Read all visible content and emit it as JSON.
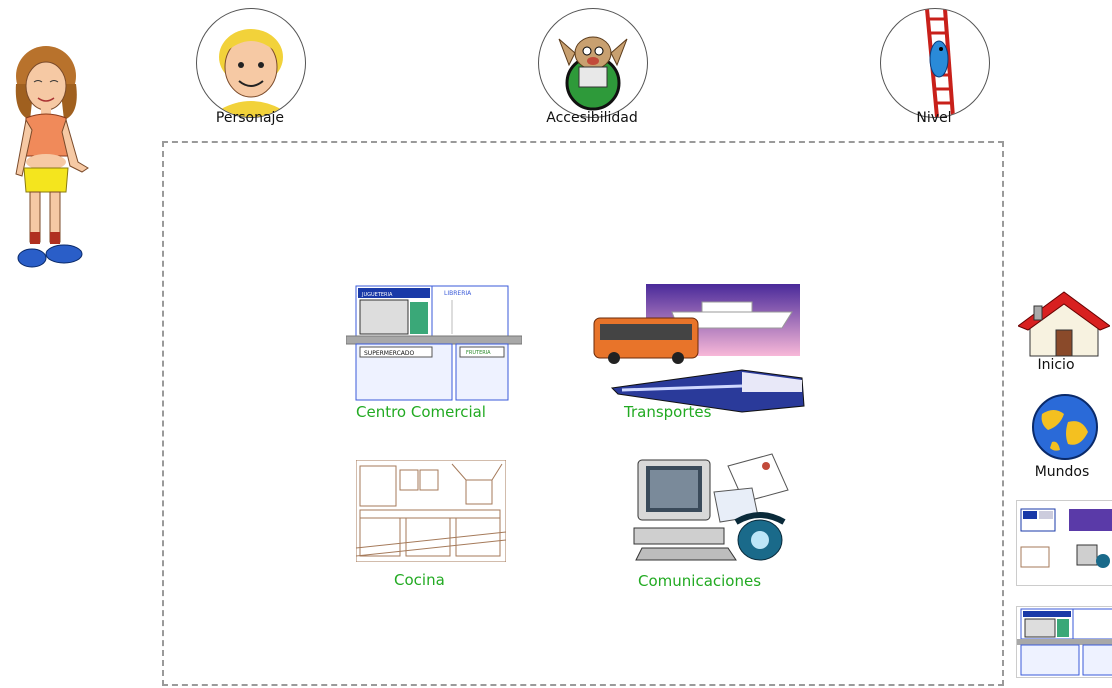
{
  "top_bar": {
    "personaje_label": "Personaje",
    "accesibilidad_label": "Accesibilidad",
    "nivel_label": "Nivel"
  },
  "worlds": [
    {
      "label": "Centro Comercial",
      "sign_top_left": "JUGUETERIA",
      "sign_top_right": "LIBRERIA",
      "sign_bottom_left": "SUPERMERCADO",
      "sign_bottom_right": "FRUTERIA"
    },
    {
      "label": "Transportes"
    },
    {
      "label": "Cocina"
    },
    {
      "label": "Comunicaciones"
    }
  ],
  "side_nav": {
    "inicio_label": "Inicio",
    "mundos_label": "Mundos"
  },
  "colors": {
    "label_green": "#22aa22",
    "frame_gray": "#9a9a9a"
  }
}
